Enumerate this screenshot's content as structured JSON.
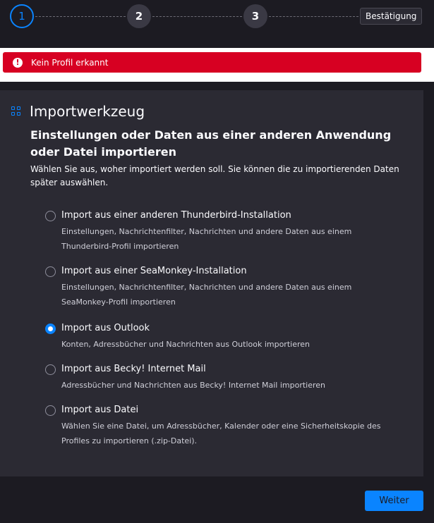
{
  "stepper": {
    "steps": [
      "1",
      "2",
      "3"
    ],
    "confirm_label": "Bestätigung"
  },
  "alert": {
    "icon": "exclamation-circle-icon",
    "text": "Kein Profil erkannt",
    "color": "#d70022"
  },
  "main": {
    "title": "Importwerkzeug",
    "title_icon": "grid-icon",
    "subheading": "Einstellungen oder Daten aus einer anderen Anwendung oder Datei importieren",
    "intro": "Wählen Sie aus, woher importiert werden soll. Sie können die zu importierenden Daten später auswählen.",
    "options": [
      {
        "label": "Import aus einer anderen Thunderbird-Installation",
        "description": "Einstellungen, Nachrichtenfilter, Nachrichten und andere Daten aus einem Thunderbird-Profil importieren",
        "selected": false
      },
      {
        "label": "Import aus einer SeaMonkey-Installation",
        "description": "Einstellungen, Nachrichtenfilter, Nachrichten und andere Daten aus einem SeaMonkey-Profil importieren",
        "selected": false
      },
      {
        "label": "Import aus Outlook",
        "description": "Konten, Adressbücher und Nachrichten aus Outlook importieren",
        "selected": true
      },
      {
        "label": "Import aus Becky! Internet Mail",
        "description": "Adressbücher und Nachrichten aus Becky! Internet Mail importieren",
        "selected": false
      },
      {
        "label": "Import aus Datei",
        "description": "Wählen Sie eine Datei, um Adressbücher, Kalender oder eine Sicherheitskopie des Profiles zu importieren (.zip-Datei).",
        "selected": false
      }
    ]
  },
  "footer": {
    "next_label": "Weiter"
  },
  "colors": {
    "accent": "#0a84ff",
    "background": "#1c1b22",
    "panel": "#2b2a33"
  }
}
